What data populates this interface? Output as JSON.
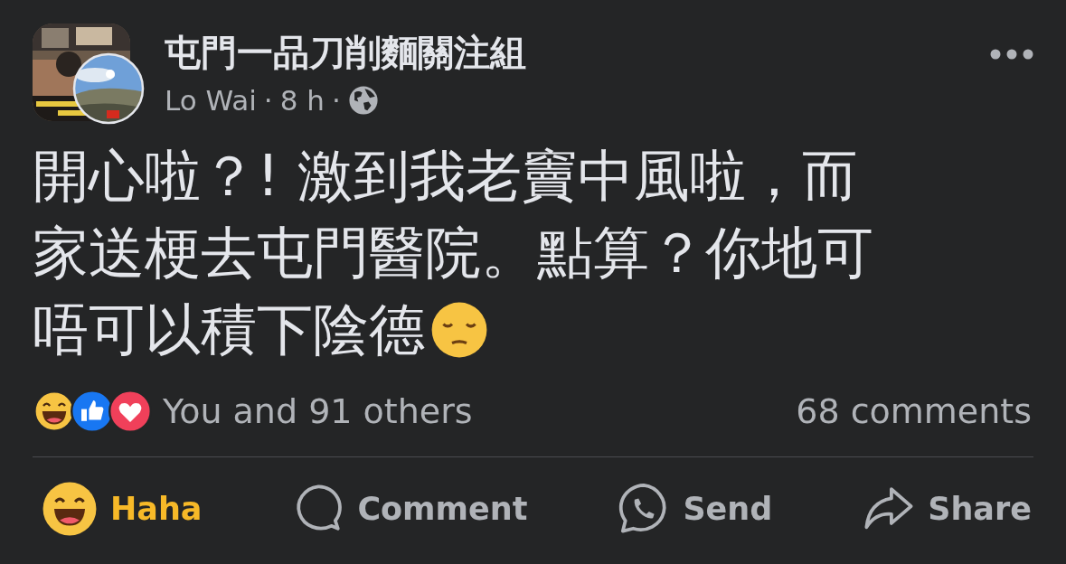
{
  "post": {
    "group_name": "屯門一品刀削麵關注組",
    "author": "Lo Wai",
    "separator_1": "·",
    "time": "8 h",
    "separator_2": "·",
    "text_lines": [
      "開心啦？! 激到我老竇中風啦，而",
      "家送梗去屯門醫院。點算？你地可",
      "唔可以積下陰德"
    ]
  },
  "reactions": {
    "summary": "You and 91 others",
    "comments": "68 comments"
  },
  "actions": [
    {
      "kind": "reaction",
      "label": "Haha",
      "selected": true
    },
    {
      "kind": "comment",
      "label": "Comment",
      "selected": false
    },
    {
      "kind": "send",
      "label": "Send",
      "selected": false
    },
    {
      "kind": "share",
      "label": "Share",
      "selected": false
    }
  ]
}
